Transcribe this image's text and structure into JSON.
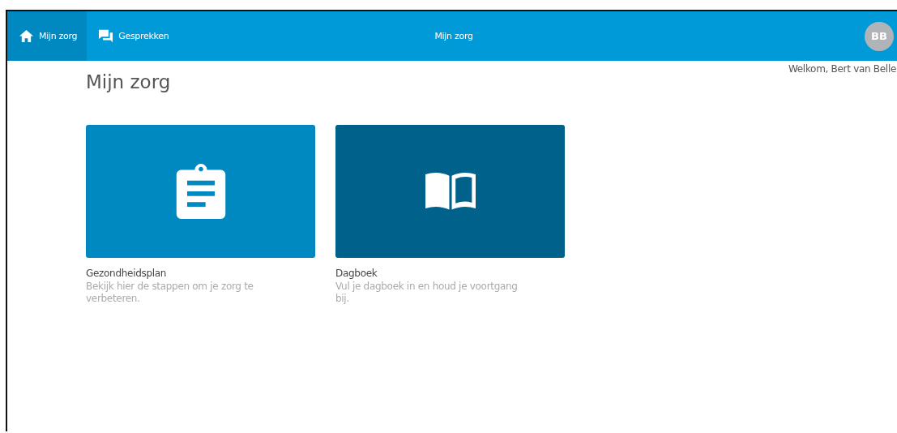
{
  "navbar": {
    "tabs": [
      {
        "label": "Mijn zorg",
        "kind": "home",
        "selected": true
      },
      {
        "label": "Gesprekken",
        "kind": "chat",
        "selected": false
      }
    ],
    "title": "Mijn zorg",
    "avatar": "BB"
  },
  "welcome": "Welkom, Bert van Belle",
  "page_title": "Mijn zorg",
  "cards": [
    {
      "kind": "clipboard",
      "color": "#0088c0",
      "title": "Gezondheidsplan",
      "description": "Bekijk hier de stappen om je zorg te verbeteren."
    },
    {
      "kind": "book",
      "color": "#00628a",
      "title": "Dagboek",
      "description": "Vul je dagboek in en houd je voortgang bij."
    }
  ]
}
